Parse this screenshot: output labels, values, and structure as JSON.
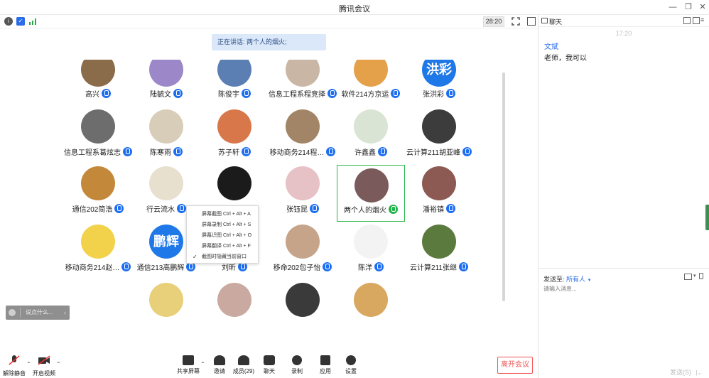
{
  "window": {
    "title": "腾讯会议"
  },
  "status": {
    "timer": "28:20"
  },
  "banner": {
    "speaking": "正在讲话: 两个人的烟火;"
  },
  "participants": [
    {
      "name": "高兴",
      "row": 0,
      "col": 0,
      "mic": "blue",
      "avatar_color": "#8a6b4a"
    },
    {
      "name": "陆毓文",
      "row": 0,
      "col": 1,
      "mic": "blue",
      "avatar_color": "#9c87c9"
    },
    {
      "name": "陈俊宇",
      "row": 0,
      "col": 2,
      "mic": "blue",
      "avatar_color": "#5b7fb3"
    },
    {
      "name": "信息工程系程竞择",
      "row": 0,
      "col": 3,
      "mic": "blue",
      "avatar_color": "#c9b6a4"
    },
    {
      "name": "软件214方京运",
      "row": 0,
      "col": 4,
      "mic": "blue",
      "avatar_color": "#e5a14a"
    },
    {
      "name": "张洪彩",
      "row": 0,
      "col": 5,
      "mic": "blue",
      "avatar_color": "#1f78e8",
      "avatar_text": "洪彩"
    },
    {
      "name": "信息工程系葛炫志",
      "row": 1,
      "col": 0,
      "mic": "blue",
      "avatar_color": "#6d6d6d"
    },
    {
      "name": "陈寒雨",
      "row": 1,
      "col": 1,
      "mic": "blue",
      "avatar_color": "#d8cdb8"
    },
    {
      "name": "苏子轩",
      "row": 1,
      "col": 2,
      "mic": "blue",
      "avatar_color": "#d7774a"
    },
    {
      "name": "移动商务214程…",
      "row": 1,
      "col": 3,
      "mic": "blue",
      "avatar_color": "#a28466"
    },
    {
      "name": "许鑫鑫",
      "row": 1,
      "col": 4,
      "mic": "blue",
      "avatar_color": "#d9e4d4"
    },
    {
      "name": "云计算211胡亚峰",
      "row": 1,
      "col": 5,
      "mic": "blue",
      "avatar_color": "#3c3c3c"
    },
    {
      "name": "通信202简浩",
      "row": 2,
      "col": 0,
      "mic": "blue",
      "avatar_color": "#c4883a"
    },
    {
      "name": "行云流水",
      "row": 2,
      "col": 1,
      "mic": "blue",
      "avatar_color": "#e8e0cf"
    },
    {
      "name": "",
      "row": 2,
      "col": 2,
      "mic": "none",
      "avatar_color": "#1b1b1b"
    },
    {
      "name": "张钰昆",
      "row": 2,
      "col": 3,
      "mic": "blue",
      "avatar_color": "#e6c2c6"
    },
    {
      "name": "两个人的烟火",
      "row": 2,
      "col": 4,
      "mic": "green",
      "avatar_color": "#7a5a5a",
      "active": true
    },
    {
      "name": "潘裕镇",
      "row": 2,
      "col": 5,
      "mic": "blue",
      "avatar_color": "#8c5a52"
    },
    {
      "name": "移动商务214赵…",
      "row": 3,
      "col": 0,
      "mic": "blue",
      "avatar_color": "#f2d24a"
    },
    {
      "name": "通信213高鹏辉",
      "row": 3,
      "col": 1,
      "mic": "blue",
      "avatar_color": "#1f78e8",
      "avatar_text": "鹏辉"
    },
    {
      "name": "刘昕",
      "row": 3,
      "col": 2,
      "mic": "blue",
      "avatar_color": "#9a8f86"
    },
    {
      "name": "移命202包子怡",
      "row": 3,
      "col": 3,
      "mic": "blue",
      "avatar_color": "#c6a48a"
    },
    {
      "name": "陈洋",
      "row": 3,
      "col": 4,
      "mic": "blue",
      "avatar_color": "#f3f3f3"
    },
    {
      "name": "云计算211张继",
      "row": 3,
      "col": 5,
      "mic": "blue",
      "avatar_color": "#5a7a3e"
    },
    {
      "name": "",
      "row": 4,
      "col": 1,
      "mic": "none",
      "avatar_color": "#e8d07a"
    },
    {
      "name": "",
      "row": 4,
      "col": 2,
      "mic": "none",
      "avatar_color": "#c9a9a0"
    },
    {
      "name": "",
      "row": 4,
      "col": 3,
      "mic": "none",
      "avatar_color": "#3a3a3a"
    },
    {
      "name": "",
      "row": 4,
      "col": 4,
      "mic": "none",
      "avatar_color": "#d9a860"
    }
  ],
  "context_menu": {
    "items": [
      "屏幕截图 Ctrl + Alt + A",
      "屏幕录制 Ctrl + Alt + S",
      "屏幕识图 Ctrl + Alt + O",
      "屏幕翻译 Ctrl + Alt + F"
    ],
    "checked_item": "截图时隐藏当前窗口"
  },
  "say_bar": {
    "placeholder": "说点什么..."
  },
  "toolbar": {
    "unmute": "解除静音",
    "video": "开启视频",
    "share": "共享屏幕",
    "invite": "邀请",
    "members": "成员(29)",
    "chat": "聊天",
    "record": "录制",
    "apps": "应用",
    "settings": "设置",
    "leave": "离开会议"
  },
  "chat_panel": {
    "title": "聊天",
    "time": "17:20",
    "sender": "文斌",
    "message": "老师，我可以",
    "send_to_label": "发送至:",
    "send_to_value": "所有人",
    "input_placeholder": "请输入消息...",
    "send_button": "发送(S)"
  }
}
